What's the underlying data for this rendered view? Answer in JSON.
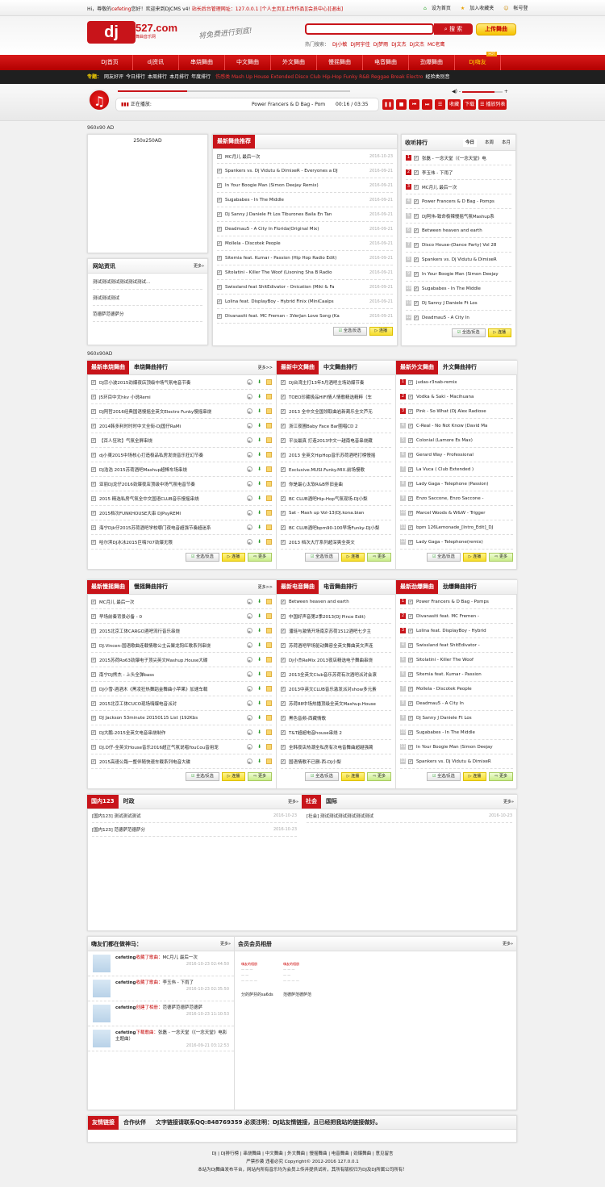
{
  "topbar": {
    "greeting": "Hi，尊敬的",
    "user": "cefeting",
    "greeting2": "您好！欢迎来到DJCMS v4! ",
    "admin": "站长后台管理网址：127.0.0.1",
    "links": [
      "[个人主页]",
      "[上传作品]",
      "[会员中心]",
      "[退出]"
    ],
    "right": [
      "设为首页",
      "加入收藏夹",
      "帐号登"
    ]
  },
  "header": {
    "logo": "dj",
    "logo_num": "527.com",
    "logo_sub": "舞曲音乐网",
    "slogan": "将免费进行到底!",
    "search_value": "",
    "search_btn": "搜 索",
    "upload_btn": "上传舞曲",
    "hot_label": "热门搜索：",
    "hot": [
      "DJ小敏",
      "DJ阿宇佳",
      "DJ梦雨",
      "DJ文杰",
      "DJ文杰",
      "MC老鹰"
    ]
  },
  "nav": {
    "items": [
      "DJ首页",
      "dj资讯",
      "串烧舞曲",
      "中文舞曲",
      "外文舞曲",
      "慢摇舞曲",
      "电音舞曲",
      "劲爆舞曲",
      "DJ嗨友"
    ],
    "hot_badge": "HOT"
  },
  "subnav": {
    "label": "专题：",
    "links": [
      "网友好评",
      "今日排行",
      "本周排行",
      "本月排行",
      "年度排行"
    ],
    "tags": "伤感类 Mash Up House Extended Disco Club Hip-Hop Funky R&B Reggae Break Electro",
    "last": "经验类别音"
  },
  "player": {
    "now_playing_label": "正在播放:",
    "track": "Power Francers & D Bag - Pom",
    "time": "00:16 / 03:35",
    "progress": 0.3,
    "volume": 0.8,
    "buttons": [
      "收藏",
      "下载",
      "播放列表"
    ]
  },
  "ads": {
    "top": "960x90 AD",
    "side": "250x250AD",
    "mid": "960x90AD"
  },
  "site_news": {
    "title": "网站资讯",
    "more": "更多»",
    "items": [
      "测试测试测试测试测试测试...",
      "测试测试测试",
      "范德萨范德萨分"
    ]
  },
  "latest": {
    "title": "最新舞曲推荐",
    "items": [
      [
        "MC月儿 最后一次",
        "2016-10-23"
      ],
      [
        "Spankers vs. Dj Vidutu & DimixeR - Everyones a DJ",
        "2016-09-21"
      ],
      [
        "In Your Boogie Man (Simon Deejay Remix)",
        "2016-09-21"
      ],
      [
        "Sugababes - In The Middle",
        "2016-09-21"
      ],
      [
        "Dj Sanny J Daniele Ft Los Tiburones Baila En Tan",
        "2016-09-21"
      ],
      [
        "Deadmau5 - A City In Florida(Original Mix)",
        "2016-09-21"
      ],
      [
        "Mollela - Discotek People",
        "2016-09-21"
      ],
      [
        "Sitemia feat. Kumar - Passion (Hip Hop Radio Edit)",
        "2016-09-21"
      ],
      [
        "Sitolatini - Killer The Woof (Lisoning Sha B Radio",
        "2016-09-21"
      ],
      [
        "Swissland feat ShitEdivator - Onication (Miki & Fa",
        "2016-09-21"
      ],
      [
        "Lolina feat. DisplayBoy - Hybrid Finix (MiniCaalps",
        "2016-09-21"
      ],
      [
        "Divanasiti feat. MC Freman - 3VerJan Love Song (Ka",
        "2016-09-21"
      ]
    ],
    "select_btn": "全选/反选",
    "play_btn": "连播"
  },
  "ranking": {
    "title": "收听排行",
    "tabs": [
      "今日",
      "本周",
      "本月"
    ],
    "items": [
      "张磊 - 一念天堂（《一念天堂》电",
      "李玉伟 - 下雨了",
      "MC月儿 最后一次",
      "Power Francers & D Bag - Pomps",
      "DJ阿伟-致命极辣慢摇气氛Mashup系",
      "Between heaven and earth",
      "Disco House-(Dance Party) Vol 28",
      "Spankers vs. Dj Vidutu & DimixeR",
      "In Your Boogie Man (Simon Deejay",
      "Sugababes - In The Middle",
      "Dj Sanny J Daniele Ft Los",
      "Deadmau5 - A City In"
    ],
    "select_btn": "全选/反选",
    "play_btn": "连播"
  },
  "sections": [
    {
      "tab1": "最新串烧舞曲",
      "tab2": "串烧舞曲排行",
      "more": "更多>>",
      "items": [
        "DJ宗小波2015劲爆夜店顶级中场气氛电音节奏",
        "J5环目中文hkv 小说Remi",
        "DJ阿哲2016经典国语慢摇全英文Electro Funky慢摇串烧",
        "2014韩多利时时时中文全街-DJ国仔RaMi",
        "【百人狂欢】气氛全屏串烧",
        "dj小東2015中场核心打造极品私房发烧音乐狂幻节奏",
        "DJ浩浩 2015苏荷酒吧Mashup超棒车场串烧",
        "亚丽DJ龙仔2016劲爆夜店顶级中场气氛电音节奏",
        "2015 精选私房气氛全中文国语CLUB音乐慢摇串烧",
        "2015档次FUNKHOUSE大串 DJPsyREMI",
        "海宁Djk仔2015苏荷酒吧学校哪门夜电音超强节奏超迷系",
        "哈尔滨DJ冰冰2015巨嗨707劲爆无限"
      ],
      "type": "icons"
    },
    {
      "tab1": "最新中文舞曲",
      "tab2": "中文舞曲排行",
      "items": [
        "DJ台湾主打13年5月酒吧主场劲爆节奏",
        "TOEO珍藏极品HIFI情人情歌精选精粹（车",
        "2013 全中文全国领取曲岩新蔺乐全文芦无",
        "浙江夜圃Baby Face Bar圈唱CD 2",
        "平淡最真 打造2013中文一越南电音串烧藏",
        "2013 全英文HipHop音乐苏荷酒吧打榜慢摇",
        "Exclusive.MUSI.Funky.MIX.前场慢歌",
        "你是最心太软R&B怀旧金曲",
        "BC CLUB酒吧Hip-Hop气氛现场-DJ小梨",
        "Sat - Mash up Vol-13(DJ.kona.bian",
        "BC CLUB酒吧bpm90-100早场Funky-DJ小梨",
        "2013 档次大厅系列超深爽全英文"
      ],
      "type": "plain"
    },
    {
      "tab1": "最新外文舞曲",
      "tab2": "外文舞曲排行",
      "items": [
        "judas-r3nab-remix",
        "Vodka & Saki - Macihuana",
        "Pink - So What (Dj Alex Radiose",
        "C-Real - No Not Know (David Ma",
        "Colonial (Lamore Es Max)",
        "Gerard Way - Professional",
        "La Vuca ( Club Extended )",
        "Lady Gaga - Telephone (Passion)",
        "Enzo Saccone, Enzo Saccone -",
        "Marcel Woods & W&W - Trigger",
        "bpm 126Lemonade_[Intro_Edit]_DJ",
        "Lady Gaga - Telephone(remix)"
      ],
      "type": "rank"
    },
    {
      "tab1": "最新慢摇舞曲",
      "tab2": "慢摇舞曲排行",
      "more": "更多>>",
      "items": [
        "MC月儿 最后一次",
        "早场前奏背景必备 - 0",
        "2015北京工体CARGO酒吧流行音乐串烧",
        "DJ.Vincen-国语歌曲连载情歌公主云聚龙钩红歌系列串烧",
        "2015苏荷Ro63劲爆电子顶尖英文Mashup.House大碟",
        "南宁DJ熊杰 - 上头全弹bass",
        "DJ小雪-酒酒木《黑凌狂热舞蹈金舞曲小苹果》加速车载",
        "2015北京工体CUCO现场嗨爆电音派对",
        "DJ Jackson 53minute 20150115 List (192Kbs",
        "DJ大鹏-2015全英文电音串烧制作",
        "DJ.D仔-全英文House音乐2016超正气氛说唱YouCou音用宠",
        "2015高速公路一整伴随快速车载系列电音大碟"
      ],
      "type": "icons"
    },
    {
      "tab1": "最新电音舞曲",
      "tab2": "电音舞曲排行",
      "items": [
        "Between heaven and earth",
        "中国好声音第2季2013(DJ Pince Edit)",
        "潘琏与激情开场南京苏荷1512酒吧七夕主",
        "苏荷酒吧早场驱动舞容全英文舞曲英文声连",
        "Dj小杰ReMix 2013夜店精选电子舞曲串烧",
        "2013全英文Club音乐苏荷有次酒吧派对会滚",
        "2013中英文CLUB音乐激发派对show多元素",
        "苏荷88中场热播顶级全英文Mashup.House",
        "黑色音频-西藏情歌",
        "T&T超超电音house串烧 2",
        "全韩夜店热潮全私房有次电音舞曲超越强蔺",
        "国语情歌不已删-西-DJ小梨"
      ],
      "type": "plain"
    },
    {
      "tab1": "最新劲爆舞曲",
      "tab2": "劲爆舞曲排行",
      "items": [
        "Power Francers & D Bag - Pomps",
        "Divanasiti feat. MC Fremen -",
        "Lolina feat. DisplayBoy - Hybrid",
        "Swissland feat ShitEdivator -",
        "Sitolatini - Killer The Woof",
        "Sitemia feat. Kumar - Passion",
        "Mollela - Discotek People",
        "Deadmau5 - A City In",
        "Dj Sanny J Daniele Ft Los",
        "Sugababes - In The Middle",
        "In Your Boogie Man (Simon Deejay",
        "Spankers vs. Dj Vidutu & DimixeR"
      ],
      "type": "rank"
    }
  ],
  "list_buttons": {
    "select": "全选/反选",
    "play": "连播",
    "more": "更多"
  },
  "news": [
    {
      "tab1": "国内123",
      "tab2": "时政",
      "more": "更多»",
      "items": [
        [
          "[国内123] 测试测试测试",
          "2016-10-23"
        ],
        [
          "[国内123] 范德萨范德萨分",
          "2016-10-23"
        ]
      ]
    },
    {
      "tab1": "社会",
      "tab2": "国际",
      "more": "更多»",
      "items": [
        [
          "[社会] 测试测试测试测试测试测试",
          "2016-10-23"
        ]
      ]
    }
  ],
  "activity": {
    "title": "嗨友们都在做神马：",
    "more": "更多»",
    "items": [
      {
        "user": "cefeting",
        "action": "收藏了歌曲：",
        "target": "MC月儿 最后一次",
        "time": "2016-10-23 02:44:50"
      },
      {
        "user": "cefeting",
        "action": "收藏了歌曲：",
        "target": "李玉伟 - 下雨了",
        "time": "2016-10-23 02:35:50"
      },
      {
        "user": "cefeting",
        "action": "创建了相册：",
        "target": "范德萨范德萨范德萨",
        "time": "2016-10-23 11:10:53"
      },
      {
        "user": "cefeting",
        "action": "下载歌曲：",
        "target": "张磊 - 一念天堂（《一念天堂》电影主题曲）",
        "time": "2016-09-21 03:12:53"
      }
    ]
  },
  "albums": {
    "title": "会员会员相册",
    "more": "更多»",
    "items": [
      "分的萨芬的sa6ds",
      "范德萨范德萨范"
    ],
    "thumb_text": "嗨友的相册"
  },
  "links": {
    "tab1": "友情链接",
    "tab2": "合作伙伴",
    "text": "文字链接请联系QQ:848769359 必须注明：DJ站友情链接，且已经把我站的链接做好。"
  },
  "footer": {
    "links": "DJ | DJ排行榜 | 串烧舞曲 | 中文舞曲 | 外文舞曲 | 慢摇舞曲 | 电音舞曲 | 劲爆舞曲 | 意见留言",
    "copy": "严禁抄袭 违者必究 Copyright© 2012-2016 127.0.0.1",
    "notice": "本站为DJ舞曲发布平台，网站内所有音乐均为会员上传并提供试听，其所有版权归为DJ及DJ所属公司所有！"
  },
  "colors": {
    "brand": "#c8141a",
    "nav_dark": "#1f1f1f",
    "highlight": "#ffd800"
  }
}
